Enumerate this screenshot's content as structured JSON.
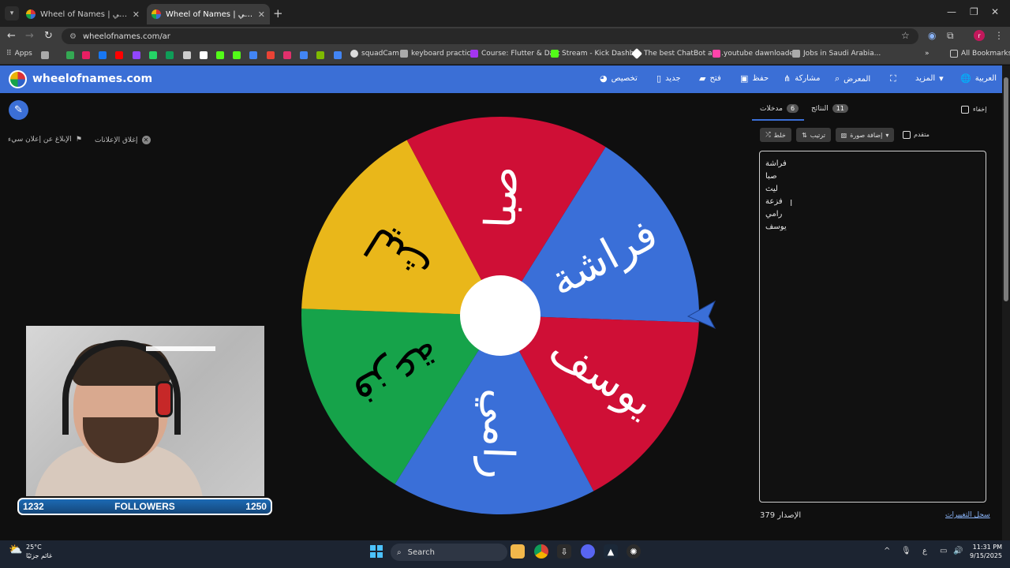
{
  "browser": {
    "tabs": [
      {
        "title": "Wheel of Names | عجلة الاسم العشوائي"
      },
      {
        "title": "Wheel of Names | عجلة الاسم العشوائي"
      }
    ],
    "url": "wheelofnames.com/ar",
    "bookmarks": [
      "Apps",
      "squadCam",
      "keyboard practice",
      "Course: Flutter & Dart",
      "Stream - Kick Dashb...",
      "The best ChatBot an...",
      "youtube dawnloader",
      "Jobs in Saudi Arabia...",
      "All Bookmarks"
    ],
    "profile_initial": "r"
  },
  "site": {
    "logo_text": "wheelofnames.com",
    "menu": {
      "language": "العربية",
      "more": "المزيد",
      "fullscreen": "",
      "gallery": "المعرض",
      "share": "مشاركة",
      "save": "حفظ",
      "open": "فتح",
      "new": "جديد",
      "customize": "تخصيص"
    },
    "close_ads": "إغلاق الإعلانات",
    "report_ad": "الإبلاغ عن إعلان سيء"
  },
  "stream": {
    "followers_label": "FOLLOWERS",
    "followers_current": "1232",
    "followers_goal": "1250"
  },
  "wheel": {
    "segments": [
      {
        "label": "فراشة",
        "color": "#3a6fd8",
        "text_color": "#ffffff"
      },
      {
        "label": "يوسف",
        "color": "#cf0f36",
        "text_color": "#ffffff"
      },
      {
        "label": "رامي",
        "color": "#3a6fd8",
        "text_color": "#ffffff"
      },
      {
        "label": "فزعة",
        "color": "#16a34a",
        "text_color": "#000000"
      },
      {
        "label": "ليث",
        "color": "#e9b71a",
        "text_color": "#000000"
      },
      {
        "label": "صبا",
        "color": "#cf0f36",
        "text_color": "#ffffff"
      }
    ],
    "pointer_color": "#3a6fd8"
  },
  "panel": {
    "tab_entries": "مدخلات",
    "tab_entries_count": "6",
    "tab_results": "النتائج",
    "tab_results_count": "11",
    "hide_label": "إخفاء",
    "shuffle_label": "خلط",
    "sort_label": "ترتيب",
    "add_image_label": "إضافة صورة",
    "advanced_label": "متقدم",
    "entries": [
      "فراشة",
      "صبا",
      "ليث",
      "فزعة",
      "رامي",
      "يوسف"
    ],
    "version": "الإصدار 379",
    "changelog": "سجل التغييرات"
  },
  "taskbar": {
    "temperature": "25°C",
    "weather_caption": "غائم جزئيًا",
    "search_label": "Search",
    "time": "11:31 PM",
    "date": "9/15/2025",
    "lang": "ع"
  }
}
